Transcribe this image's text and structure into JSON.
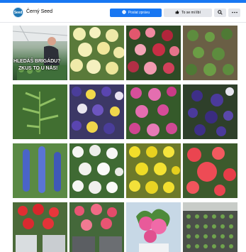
{
  "header": {
    "avatar_text": "Seed",
    "page_name": "Černý Seed",
    "send_message": "Poslat zprávu",
    "like": "To se mi líbí",
    "search_icon": "search-icon",
    "more_icon": "more-icon"
  },
  "photos": [
    {
      "subject": "person-in-greenhouse",
      "overlay_lines": [
        "HLEDÁŠ BRIGÁDU?",
        "ZKUS TO U NÁS!"
      ]
    },
    {
      "subject": "yellow-flowers"
    },
    {
      "subject": "red-pink-flowers"
    },
    {
      "subject": "green-seedlings"
    },
    {
      "subject": "green-foliage"
    },
    {
      "subject": "mixed-purple-yellow-flowers"
    },
    {
      "subject": "pink-flowers"
    },
    {
      "subject": "purple-statice"
    },
    {
      "subject": "blue-delphinium"
    },
    {
      "subject": "white-flowers"
    },
    {
      "subject": "yellow-flowers-dense"
    },
    {
      "subject": "red-coral-flowers"
    },
    {
      "subject": "red-begonias-pots"
    },
    {
      "subject": "pink-begonias"
    },
    {
      "subject": "pink-flower-pot"
    },
    {
      "subject": "seedling-trays"
    }
  ]
}
